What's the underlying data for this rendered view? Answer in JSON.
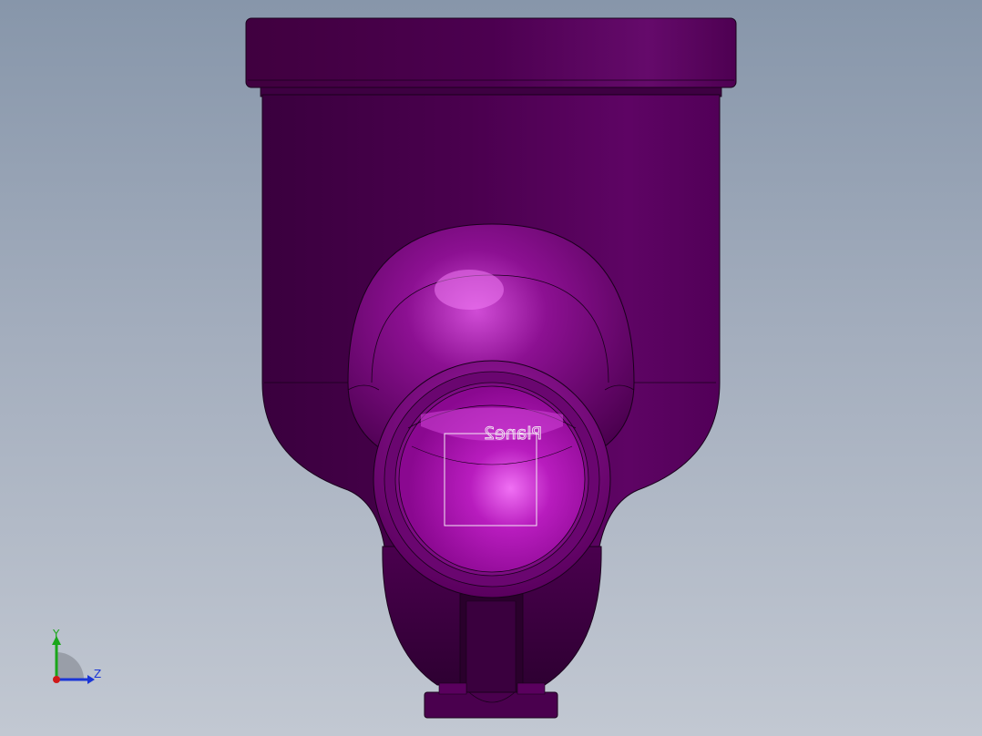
{
  "graphics_area": {
    "plane_label": "Plane2"
  },
  "triad": {
    "y_label": "Y",
    "z_label": "Z",
    "colors": {
      "y_axis": "#1aa61a",
      "z_axis": "#1a35d6",
      "x_axis": "#d01818"
    }
  },
  "model": {
    "colors": {
      "body_dark": "#3e0042",
      "body_mid": "#5a005e",
      "body_light": "#6c0a72",
      "highlight": "#e860ec",
      "bore": "#a612ac",
      "edge": "#1a001c"
    }
  }
}
